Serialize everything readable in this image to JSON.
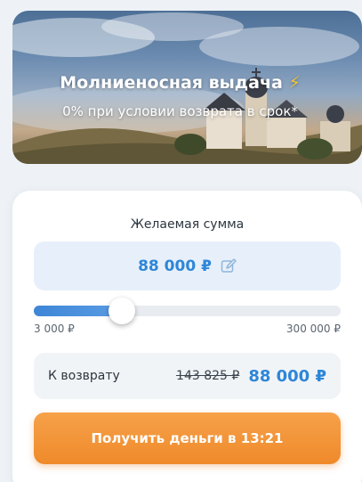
{
  "hero": {
    "title": "Молниеносная выдача",
    "bolt": "⚡",
    "subtitle": "0% при условии возврата в срок*"
  },
  "form": {
    "amount_label": "Желаемая сумма",
    "amount_value": "88 000 ₽",
    "edit_icon": "pencil-square-icon",
    "slider": {
      "min_label": "3 000 ₽",
      "max_label": "300 000 ₽",
      "min": 3000,
      "max": 300000,
      "value": 88000
    },
    "return_label": "К возврату",
    "return_old": "143 825 ₽",
    "return_new": "88 000 ₽",
    "cta_label": "Получить деньги в 13:21"
  },
  "colors": {
    "accent_blue": "#2e86d8",
    "cta_orange": "#f29233",
    "amount_bg": "#e7f0fa"
  }
}
